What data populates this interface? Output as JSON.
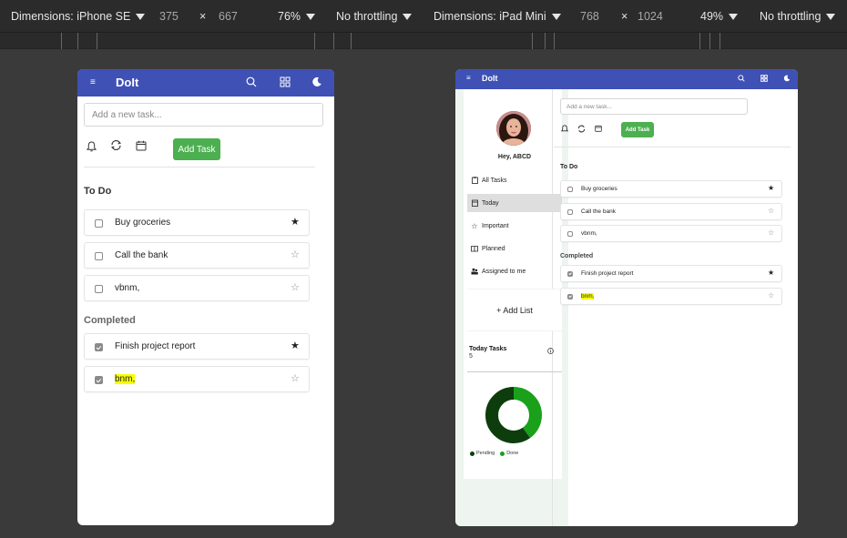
{
  "devtools": {
    "left": {
      "dimensions": "Dimensions: iPhone SE",
      "width": "375",
      "times": "×",
      "height": "667",
      "zoom": "76%",
      "throttle": "No throttling"
    },
    "right": {
      "dimensions": "Dimensions: iPad Mini",
      "width": "768",
      "times": "×",
      "height": "1024",
      "zoom": "49%",
      "throttle": "No throttling"
    }
  },
  "app": {
    "brand": "DoIt",
    "accent": "#3f51b5",
    "add_button_color": "#4caf50",
    "input_placeholder": "Add a new task...",
    "add_task_label": "Add Task",
    "todo_heading": "To Do",
    "completed_heading": "Completed",
    "todo": [
      {
        "text": "Buy groceries",
        "starred": true
      },
      {
        "text": "Call the bank",
        "starred": false
      },
      {
        "text": "vbnm,",
        "starred": false
      }
    ],
    "completed": [
      {
        "text": "Finish project report",
        "starred": true,
        "highlight": false
      },
      {
        "text": "bnm,",
        "starred": false,
        "highlight": true
      }
    ]
  },
  "sidebar": {
    "greeting": "Hey, ABCD",
    "items": [
      {
        "label": "All Tasks",
        "icon": "clipboard-icon"
      },
      {
        "label": "Today",
        "icon": "calendar-icon",
        "active": true
      },
      {
        "label": "Important",
        "icon": "star-outline-icon"
      },
      {
        "label": "Planned",
        "icon": "book-icon"
      },
      {
        "label": "Assigned to me",
        "icon": "people-icon"
      }
    ],
    "add_list": "+ Add List",
    "today_tasks_title": "Today Tasks",
    "today_tasks_count": "5",
    "legend": {
      "pending": "Pending",
      "done": "Done"
    },
    "donut": {
      "pending": 3,
      "done": 2,
      "pending_color": "#0d3d0d",
      "done_color": "#1aa01a"
    }
  }
}
